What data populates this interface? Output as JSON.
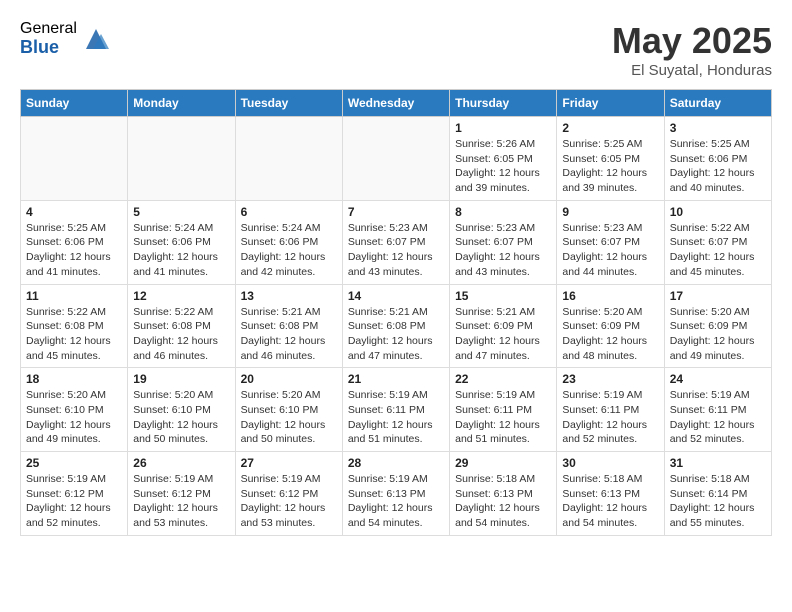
{
  "header": {
    "logo_general": "General",
    "logo_blue": "Blue",
    "month_title": "May 2025",
    "location": "El Suyatal, Honduras"
  },
  "days_of_week": [
    "Sunday",
    "Monday",
    "Tuesday",
    "Wednesday",
    "Thursday",
    "Friday",
    "Saturday"
  ],
  "weeks": [
    [
      {
        "day": "",
        "info": ""
      },
      {
        "day": "",
        "info": ""
      },
      {
        "day": "",
        "info": ""
      },
      {
        "day": "",
        "info": ""
      },
      {
        "day": "1",
        "info": "Sunrise: 5:26 AM\nSunset: 6:05 PM\nDaylight: 12 hours\nand 39 minutes."
      },
      {
        "day": "2",
        "info": "Sunrise: 5:25 AM\nSunset: 6:05 PM\nDaylight: 12 hours\nand 39 minutes."
      },
      {
        "day": "3",
        "info": "Sunrise: 5:25 AM\nSunset: 6:06 PM\nDaylight: 12 hours\nand 40 minutes."
      }
    ],
    [
      {
        "day": "4",
        "info": "Sunrise: 5:25 AM\nSunset: 6:06 PM\nDaylight: 12 hours\nand 41 minutes."
      },
      {
        "day": "5",
        "info": "Sunrise: 5:24 AM\nSunset: 6:06 PM\nDaylight: 12 hours\nand 41 minutes."
      },
      {
        "day": "6",
        "info": "Sunrise: 5:24 AM\nSunset: 6:06 PM\nDaylight: 12 hours\nand 42 minutes."
      },
      {
        "day": "7",
        "info": "Sunrise: 5:23 AM\nSunset: 6:07 PM\nDaylight: 12 hours\nand 43 minutes."
      },
      {
        "day": "8",
        "info": "Sunrise: 5:23 AM\nSunset: 6:07 PM\nDaylight: 12 hours\nand 43 minutes."
      },
      {
        "day": "9",
        "info": "Sunrise: 5:23 AM\nSunset: 6:07 PM\nDaylight: 12 hours\nand 44 minutes."
      },
      {
        "day": "10",
        "info": "Sunrise: 5:22 AM\nSunset: 6:07 PM\nDaylight: 12 hours\nand 45 minutes."
      }
    ],
    [
      {
        "day": "11",
        "info": "Sunrise: 5:22 AM\nSunset: 6:08 PM\nDaylight: 12 hours\nand 45 minutes."
      },
      {
        "day": "12",
        "info": "Sunrise: 5:22 AM\nSunset: 6:08 PM\nDaylight: 12 hours\nand 46 minutes."
      },
      {
        "day": "13",
        "info": "Sunrise: 5:21 AM\nSunset: 6:08 PM\nDaylight: 12 hours\nand 46 minutes."
      },
      {
        "day": "14",
        "info": "Sunrise: 5:21 AM\nSunset: 6:08 PM\nDaylight: 12 hours\nand 47 minutes."
      },
      {
        "day": "15",
        "info": "Sunrise: 5:21 AM\nSunset: 6:09 PM\nDaylight: 12 hours\nand 47 minutes."
      },
      {
        "day": "16",
        "info": "Sunrise: 5:20 AM\nSunset: 6:09 PM\nDaylight: 12 hours\nand 48 minutes."
      },
      {
        "day": "17",
        "info": "Sunrise: 5:20 AM\nSunset: 6:09 PM\nDaylight: 12 hours\nand 49 minutes."
      }
    ],
    [
      {
        "day": "18",
        "info": "Sunrise: 5:20 AM\nSunset: 6:10 PM\nDaylight: 12 hours\nand 49 minutes."
      },
      {
        "day": "19",
        "info": "Sunrise: 5:20 AM\nSunset: 6:10 PM\nDaylight: 12 hours\nand 50 minutes."
      },
      {
        "day": "20",
        "info": "Sunrise: 5:20 AM\nSunset: 6:10 PM\nDaylight: 12 hours\nand 50 minutes."
      },
      {
        "day": "21",
        "info": "Sunrise: 5:19 AM\nSunset: 6:11 PM\nDaylight: 12 hours\nand 51 minutes."
      },
      {
        "day": "22",
        "info": "Sunrise: 5:19 AM\nSunset: 6:11 PM\nDaylight: 12 hours\nand 51 minutes."
      },
      {
        "day": "23",
        "info": "Sunrise: 5:19 AM\nSunset: 6:11 PM\nDaylight: 12 hours\nand 52 minutes."
      },
      {
        "day": "24",
        "info": "Sunrise: 5:19 AM\nSunset: 6:11 PM\nDaylight: 12 hours\nand 52 minutes."
      }
    ],
    [
      {
        "day": "25",
        "info": "Sunrise: 5:19 AM\nSunset: 6:12 PM\nDaylight: 12 hours\nand 52 minutes."
      },
      {
        "day": "26",
        "info": "Sunrise: 5:19 AM\nSunset: 6:12 PM\nDaylight: 12 hours\nand 53 minutes."
      },
      {
        "day": "27",
        "info": "Sunrise: 5:19 AM\nSunset: 6:12 PM\nDaylight: 12 hours\nand 53 minutes."
      },
      {
        "day": "28",
        "info": "Sunrise: 5:19 AM\nSunset: 6:13 PM\nDaylight: 12 hours\nand 54 minutes."
      },
      {
        "day": "29",
        "info": "Sunrise: 5:18 AM\nSunset: 6:13 PM\nDaylight: 12 hours\nand 54 minutes."
      },
      {
        "day": "30",
        "info": "Sunrise: 5:18 AM\nSunset: 6:13 PM\nDaylight: 12 hours\nand 54 minutes."
      },
      {
        "day": "31",
        "info": "Sunrise: 5:18 AM\nSunset: 6:14 PM\nDaylight: 12 hours\nand 55 minutes."
      }
    ]
  ]
}
